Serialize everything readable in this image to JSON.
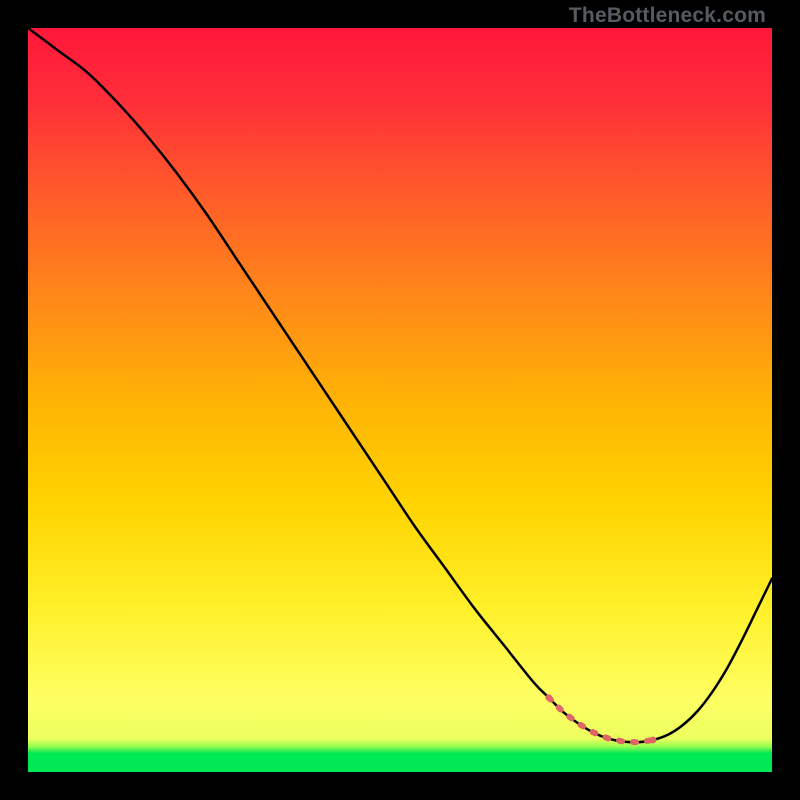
{
  "watermark": "TheBottleneck.com",
  "colors": {
    "bg": "#000000",
    "gradient_top": "#ff173a",
    "gradient_mid1": "#ff6a15",
    "gradient_mid2": "#ffd400",
    "gradient_low": "#fffd60",
    "gradient_bottom_yellow": "#f4ff62",
    "gradient_green": "#00e853",
    "curve": "#000000",
    "dash": "#e06666"
  },
  "chart_data": {
    "type": "line",
    "title": "",
    "xlabel": "",
    "ylabel": "",
    "xlim": [
      0,
      100
    ],
    "ylim": [
      0,
      100
    ],
    "series": [
      {
        "name": "bottleneck-curve",
        "x": [
          0,
          4,
          8,
          12,
          16,
          20,
          24,
          28,
          32,
          36,
          40,
          44,
          48,
          52,
          56,
          60,
          64,
          68,
          70,
          72,
          74,
          76,
          78,
          80,
          82,
          84,
          86,
          88,
          90,
          92,
          94,
          96,
          98,
          100
        ],
        "y": [
          100,
          97,
          94,
          90,
          85.5,
          80.5,
          75,
          69,
          63,
          57,
          51,
          45,
          39,
          33,
          27.5,
          22,
          17,
          12,
          10,
          8,
          6.5,
          5.3,
          4.5,
          4.1,
          4.0,
          4.3,
          5.0,
          6.3,
          8.2,
          10.8,
          14,
          17.8,
          21.9,
          26
        ]
      }
    ],
    "optimal_range_x": [
      70,
      84
    ],
    "grid": false,
    "legend": false
  }
}
